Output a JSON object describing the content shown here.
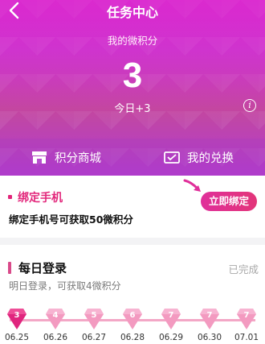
{
  "header": {
    "title": "任务中心",
    "subtitle": "我的微积分",
    "points": "3",
    "today_label": "今日+3"
  },
  "actions": [
    {
      "label": "积分商城",
      "icon": "store-icon"
    },
    {
      "label": "我的兑换",
      "icon": "ticket-icon"
    }
  ],
  "bind_task": {
    "title": "绑定手机",
    "description": "绑定手机号可获取50微积分",
    "button_label": "立即绑定"
  },
  "login_task": {
    "title": "每日登录",
    "status": "已完成",
    "description": "明日登录，可获取4微积分",
    "days": [
      {
        "num": "3",
        "date": "06.25",
        "active": true
      },
      {
        "num": "4",
        "date": "06.26",
        "active": false
      },
      {
        "num": "5",
        "date": "06.27",
        "active": false
      },
      {
        "num": "6",
        "date": "06.28",
        "active": false
      },
      {
        "num": "7",
        "date": "06.29",
        "active": false
      },
      {
        "num": "7",
        "date": "06.30",
        "active": false
      },
      {
        "num": "7",
        "date": "07.01",
        "active": false
      }
    ]
  },
  "colors": {
    "accent": "#e2257a",
    "gem_active": "#e0257e",
    "gem_inactive": "#f39ac0"
  }
}
